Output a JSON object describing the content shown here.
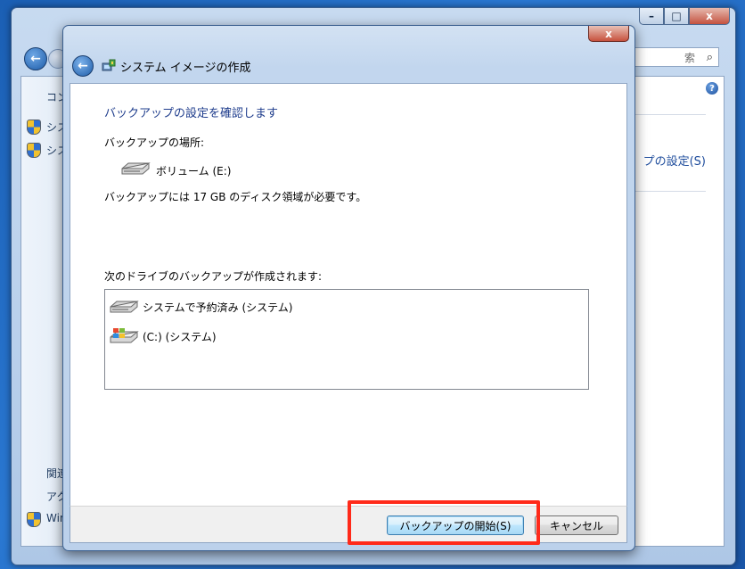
{
  "background_window": {
    "search_placeholder": "索",
    "left_items": [
      "コン",
      "シス",
      "シス",
      "関連",
      "アク",
      "Win"
    ],
    "link_right": "プの設定(S)",
    "caption": {
      "min": "–",
      "max": "□",
      "close": "x"
    },
    "help_icon": "?"
  },
  "dialog": {
    "title": "システム イメージの作成",
    "close_label": "x",
    "heading": "バックアップの設定を確認します",
    "location_label": "バックアップの場所:",
    "location_value": "ボリューム (E:)",
    "space_required": "バックアップには 17 GB のディスク領域が必要です。",
    "drives_label": "次のドライブのバックアップが作成されます:",
    "drives": [
      {
        "label": "システムで予約済み (システム)",
        "icon": "hard-drive-icon"
      },
      {
        "label": "(C:) (システム)",
        "icon": "windows-drive-icon"
      }
    ],
    "start_button": "バックアップの開始(S)",
    "cancel_button": "キャンセル"
  },
  "colors": {
    "heading": "#1e3c8c",
    "highlight": "#ff2a1a",
    "desktop": "#2a78d2"
  }
}
